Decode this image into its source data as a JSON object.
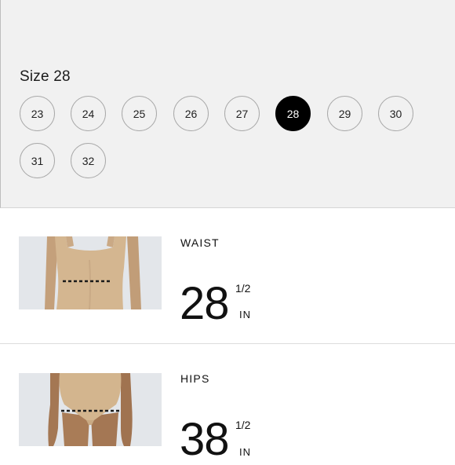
{
  "size_selector": {
    "title": "Size 28",
    "selected": "28",
    "options": [
      "23",
      "24",
      "25",
      "26",
      "27",
      "28",
      "29",
      "30",
      "31",
      "32"
    ]
  },
  "measurements": [
    {
      "label": "WAIST",
      "whole": "28",
      "fraction": "1/2",
      "unit": "IN",
      "image": "waist-measurement-photo"
    },
    {
      "label": "HIPS",
      "whole": "38",
      "fraction": "1/2",
      "unit": "IN",
      "image": "hips-measurement-photo"
    }
  ],
  "colors": {
    "panel_bg": "#f1f1f1",
    "selected_bg": "#000000",
    "selected_text": "#ffffff",
    "circle_border": "#a9a9a9",
    "skin_tone": "#c7a480",
    "bodysuit": "#d5b894",
    "measure_line": "#1a1a1a"
  }
}
